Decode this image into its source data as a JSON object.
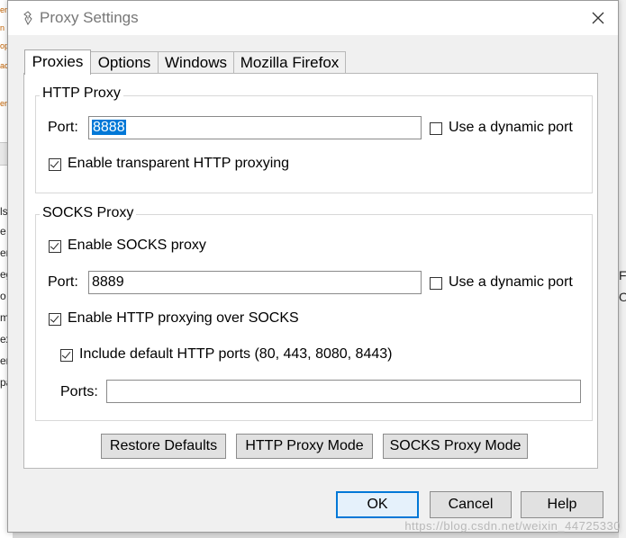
{
  "background_fragments": {
    "left": [
      "er",
      "n",
      "op",
      "ac",
      "er",
      "ls",
      "e",
      "er",
      "eg",
      "o",
      "m",
      "ex",
      "er",
      "pa"
    ],
    "right": [
      "F(",
      "Oi"
    ]
  },
  "dialog": {
    "title": "Proxy Settings",
    "tabs": [
      {
        "label": "Proxies",
        "active": true
      },
      {
        "label": "Options",
        "active": false
      },
      {
        "label": "Windows",
        "active": false
      },
      {
        "label": "Mozilla Firefox",
        "active": false
      }
    ],
    "http_proxy": {
      "group_label": "HTTP Proxy",
      "port_label": "Port:",
      "port_value": "8888",
      "dynamic_port_label": "Use a dynamic port",
      "dynamic_port_checked": false,
      "transparent_label": "Enable transparent HTTP proxying",
      "transparent_checked": true
    },
    "socks_proxy": {
      "group_label": "SOCKS Proxy",
      "enable_label": "Enable SOCKS proxy",
      "enable_checked": true,
      "port_label": "Port:",
      "port_value": "8889",
      "dynamic_port_label": "Use a dynamic port",
      "dynamic_port_checked": false,
      "http_over_socks_label": "Enable HTTP proxying over SOCKS",
      "http_over_socks_checked": true,
      "include_default_label": "Include default HTTP ports (80, 443, 8080, 8443)",
      "include_default_checked": true,
      "ports_label": "Ports:",
      "ports_value": ""
    },
    "mode_buttons": {
      "restore": "Restore Defaults",
      "http_mode": "HTTP Proxy Mode",
      "socks_mode": "SOCKS Proxy Mode"
    },
    "footer_buttons": {
      "ok": "OK",
      "cancel": "Cancel",
      "help": "Help"
    }
  },
  "watermark": "https://blog.csdn.net/weixin_44725330",
  "colors": {
    "accent": "#0078d7",
    "dialog_bg": "#f0f0f0"
  }
}
